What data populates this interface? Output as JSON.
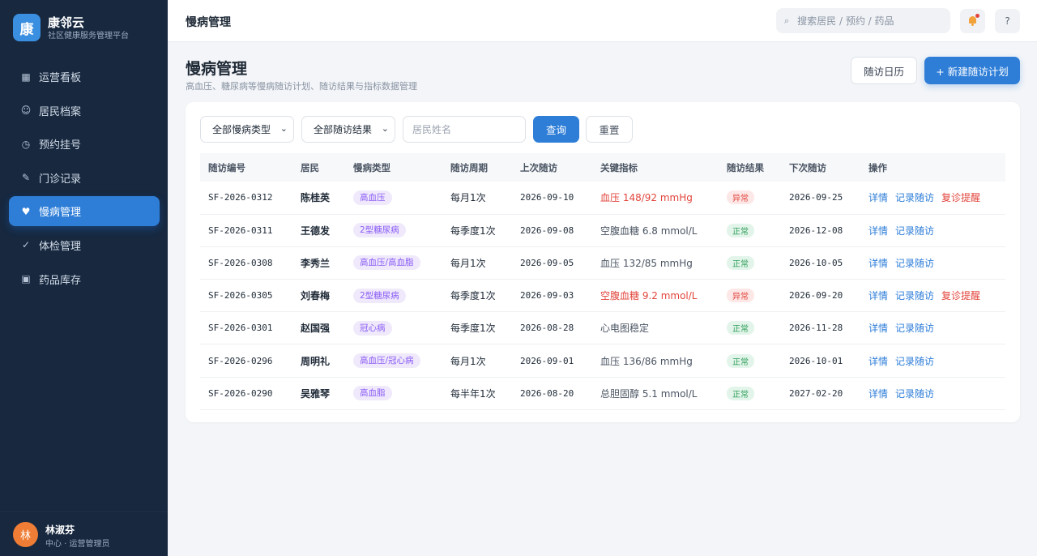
{
  "brand": {
    "logo_char": "康",
    "name": "康邻云",
    "subtitle": "社区健康服务管理平台"
  },
  "nav": [
    {
      "icon": "▦",
      "label": "运营看板",
      "active": false
    },
    {
      "icon": "☺",
      "label": "居民档案",
      "active": false
    },
    {
      "icon": "◷",
      "label": "预约挂号",
      "active": false
    },
    {
      "icon": "✎",
      "label": "门诊记录",
      "active": false
    },
    {
      "icon": "♥",
      "label": "慢病管理",
      "active": true
    },
    {
      "icon": "✓",
      "label": "体检管理",
      "active": false
    },
    {
      "icon": "▣",
      "label": "药品库存",
      "active": false
    }
  ],
  "user": {
    "avatar_char": "林",
    "name": "林淑芬",
    "role": "中心 · 运营管理员"
  },
  "topbar": {
    "title": "慢病管理",
    "search_placeholder": "搜索居民 / 预约 / 药品",
    "help": "?"
  },
  "page": {
    "title": "慢病管理",
    "subtitle": "高血压、糖尿病等慢病随访计划、随访结果与指标数据管理",
    "calendar_button": "随访日历",
    "new_button": "+ 新建随访计划"
  },
  "filters": {
    "disease_type": "全部慢病类型",
    "result": "全部随访结果",
    "name_placeholder": "居民姓名",
    "query": "查询",
    "reset": "重置"
  },
  "table": {
    "headers": [
      "随访编号",
      "居民",
      "慢病类型",
      "随访周期",
      "上次随访",
      "关键指标",
      "随访结果",
      "下次随访",
      "操作"
    ],
    "rows": [
      {
        "id": "SF-2026-0312",
        "resident": "陈桂英",
        "type": "高血压",
        "cycle": "每月1次",
        "last": "2026-09-10",
        "metric": "血压 148/92 mmHg",
        "result": "异常",
        "next": "2026-09-25",
        "actions": [
          "详情",
          "记录随访",
          "复诊提醒"
        ]
      },
      {
        "id": "SF-2026-0311",
        "resident": "王德发",
        "type": "2型糖尿病",
        "cycle": "每季度1次",
        "last": "2026-09-08",
        "metric": "空腹血糖 6.8 mmol/L",
        "result": "正常",
        "next": "2026-12-08",
        "actions": [
          "详情",
          "记录随访"
        ]
      },
      {
        "id": "SF-2026-0308",
        "resident": "李秀兰",
        "type": "高血压/高血脂",
        "cycle": "每月1次",
        "last": "2026-09-05",
        "metric": "血压 132/85 mmHg",
        "result": "正常",
        "next": "2026-10-05",
        "actions": [
          "详情",
          "记录随访"
        ]
      },
      {
        "id": "SF-2026-0305",
        "resident": "刘春梅",
        "type": "2型糖尿病",
        "cycle": "每季度1次",
        "last": "2026-09-03",
        "metric": "空腹血糖 9.2 mmol/L",
        "result": "异常",
        "next": "2026-09-20",
        "actions": [
          "详情",
          "记录随访",
          "复诊提醒"
        ]
      },
      {
        "id": "SF-2026-0301",
        "resident": "赵国强",
        "type": "冠心病",
        "cycle": "每季度1次",
        "last": "2026-08-28",
        "metric": "心电图稳定",
        "result": "正常",
        "next": "2026-11-28",
        "actions": [
          "详情",
          "记录随访"
        ]
      },
      {
        "id": "SF-2026-0296",
        "resident": "周明礼",
        "type": "高血压/冠心病",
        "cycle": "每月1次",
        "last": "2026-09-01",
        "metric": "血压 136/86 mmHg",
        "result": "正常",
        "next": "2026-10-01",
        "actions": [
          "详情",
          "记录随访"
        ]
      },
      {
        "id": "SF-2026-0290",
        "resident": "吴雅琴",
        "type": "高血脂",
        "cycle": "每半年1次",
        "last": "2026-08-20",
        "metric": "总胆固醇 5.1 mmol/L",
        "result": "正常",
        "next": "2027-02-20",
        "actions": [
          "详情",
          "记录随访"
        ]
      }
    ]
  },
  "colors": {
    "sidebar_bg": "#17283f",
    "accent": "#2e7ed8",
    "abnormal": "#e2453c",
    "normal": "#2f9e5a",
    "tag": "#8b5cf6"
  }
}
